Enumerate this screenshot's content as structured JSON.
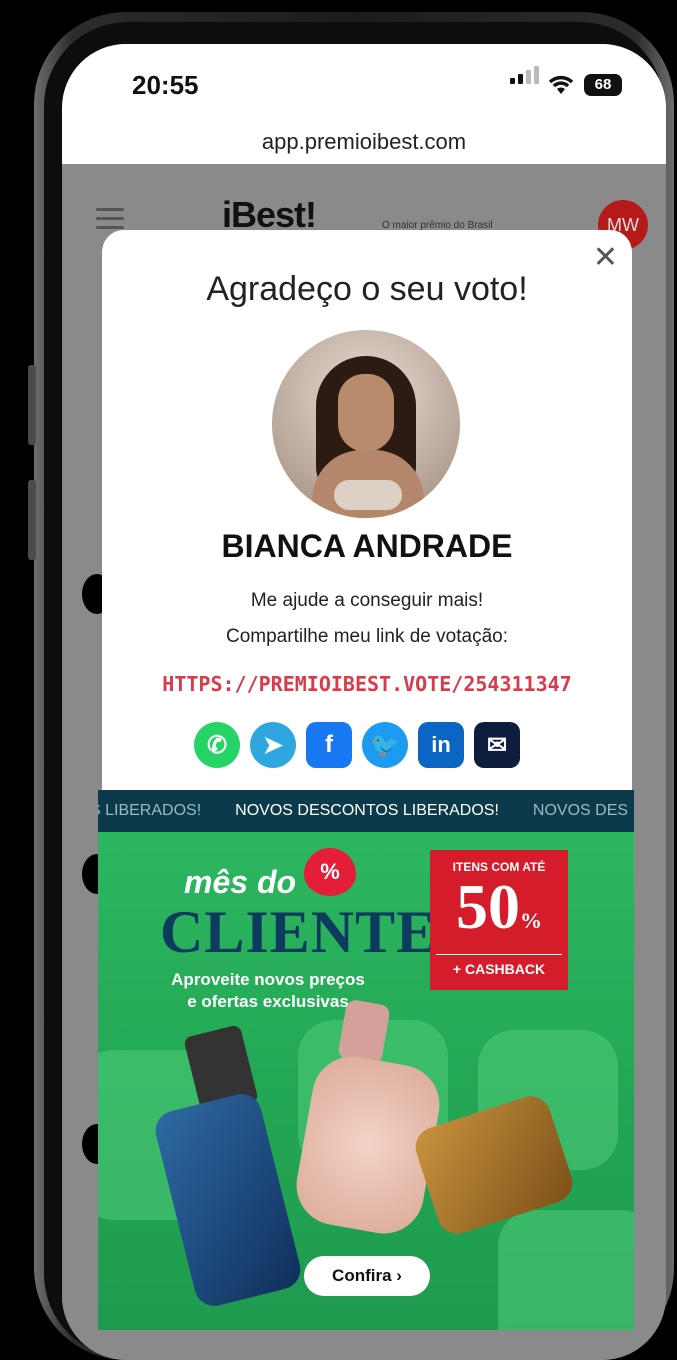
{
  "status_bar": {
    "time": "20:55",
    "battery": "68"
  },
  "browser": {
    "url": "app.premioibest.com"
  },
  "site_header": {
    "logo": "iBest!",
    "tagline": "O maior prêmio do Brasil",
    "user_initials": "MW"
  },
  "modal": {
    "title": "Agradeço o seu voto!",
    "candidate_name": "BIANCA ANDRADE",
    "help_text": "Me ajude a conseguir mais!",
    "share_text": "Compartilhe meu link de votação:",
    "vote_link": "HTTPS://PREMIOIBEST.VOTE/254311347",
    "social": [
      {
        "name": "whatsapp",
        "glyph": "✆",
        "color": "#25d366"
      },
      {
        "name": "telegram",
        "glyph": "➤",
        "color": "#2ea6e0"
      },
      {
        "name": "facebook",
        "glyph": "f",
        "color": "#1877f2"
      },
      {
        "name": "twitter",
        "glyph": "🐦",
        "color": "#1d9bf0"
      },
      {
        "name": "linkedin",
        "glyph": "in",
        "color": "#0a66c2"
      },
      {
        "name": "email",
        "glyph": "✉",
        "color": "#0e1c3d"
      }
    ]
  },
  "ad": {
    "ticker": [
      "S LIBERADOS!",
      "NOVOS DESCONTOS LIBERADOS!",
      "NOVOS DES"
    ],
    "mes_do": "mês do",
    "heart_symbol": "%",
    "cliente": "CLIENTE",
    "subtitle_1": "Aproveite novos preços",
    "subtitle_2": "e ofertas exclusivas",
    "promo_line1": "ITENS COM ATÉ",
    "promo_value": "50",
    "promo_percent": "%",
    "promo_line3": "+ CASHBACK",
    "cta": "Confira  ›"
  }
}
